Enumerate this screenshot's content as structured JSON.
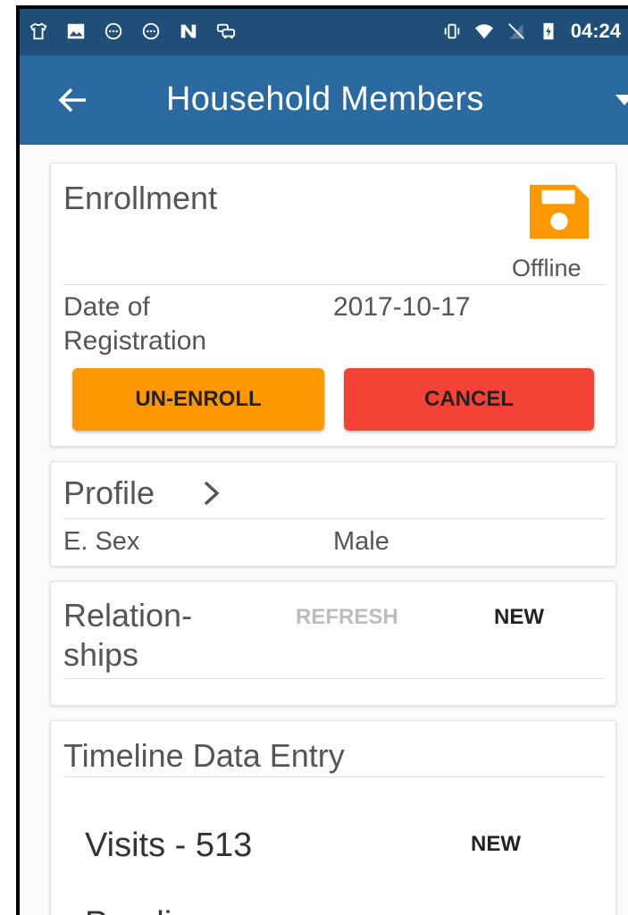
{
  "status_bar": {
    "time": "04:24",
    "left_icons": [
      "shirt-icon",
      "image-icon",
      "message-icon",
      "message-icon-2",
      "n-logo-icon",
      "car-icon"
    ],
    "right_icons": [
      "vibrate-icon",
      "wifi-icon",
      "no-sim-icon",
      "battery-icon"
    ]
  },
  "app_bar": {
    "title": "Household Members"
  },
  "enrollment": {
    "title": "Enrollment",
    "status": "Offline",
    "date_label_line1": "Date of",
    "date_label_line2": "Registration",
    "date_value": "2017-10-17",
    "unenroll_label": "UN-ENROLL",
    "cancel_label": "CANCEL"
  },
  "profile": {
    "title": "Profile",
    "field_label": "E. Sex",
    "field_value": "Male"
  },
  "relationships": {
    "title_line1": "Relation-",
    "title_line2": "ships",
    "refresh_label": "REFRESH",
    "new_label": "NEW"
  },
  "timeline": {
    "title": "Timeline Data Entry",
    "visits_label": "Visits - 513",
    "new_label": "NEW",
    "next_item_partial": "Peadi"
  },
  "colors": {
    "status_bar": "#1f4f78",
    "app_bar": "#2a6aa0",
    "orange": "#ff9800",
    "red": "#f44336"
  }
}
